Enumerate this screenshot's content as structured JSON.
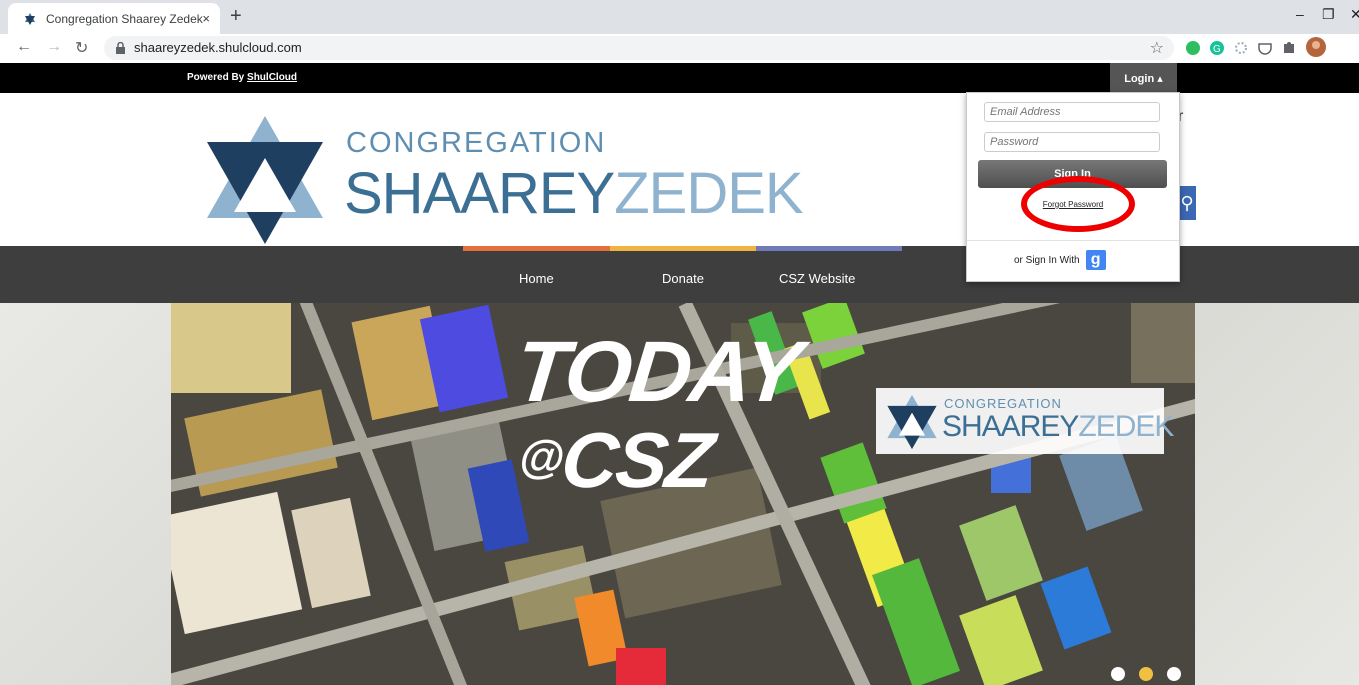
{
  "browser": {
    "tab_title": "Congregation Shaarey Zedek",
    "tab_close": "×",
    "new_tab": "+",
    "url": "shaareyzedek.shulcloud.com",
    "window": {
      "minimize": "–",
      "restore": "❐",
      "close": "✕"
    }
  },
  "topbar": {
    "powered_prefix": "Powered By ",
    "powered_link": "ShulCloud",
    "login_label": "Login ▴"
  },
  "logo": {
    "line1": "CONGREGATION",
    "line2a": "SHAAREY",
    "line2b": "ZEDEK"
  },
  "nav": {
    "items": [
      {
        "label": "Home"
      },
      {
        "label": "Donate"
      },
      {
        "label": "CSZ Website"
      }
    ],
    "strip_colors": [
      "#e2703a",
      "#f0b240",
      "#f0b240",
      "#6f7bb8"
    ]
  },
  "hero": {
    "headline1": "TODAY",
    "headline2_at": "@",
    "headline2_text": "CSZ",
    "logo_line1": "CONGREGATION",
    "logo_line2a": "SHAAREY",
    "logo_line2b": "ZEDEK",
    "slide_dots": [
      "#ffffff",
      "#f0c040",
      "#ffffff"
    ]
  },
  "login": {
    "email_placeholder": "Email Address",
    "password_placeholder": "Password",
    "sign_in_label": "Sign In",
    "forgot_label": "Forgot Password",
    "or_sign_in_with": "or Sign In With",
    "google_icon": "g"
  },
  "annotation": {
    "highlight_color": "#e00000"
  }
}
